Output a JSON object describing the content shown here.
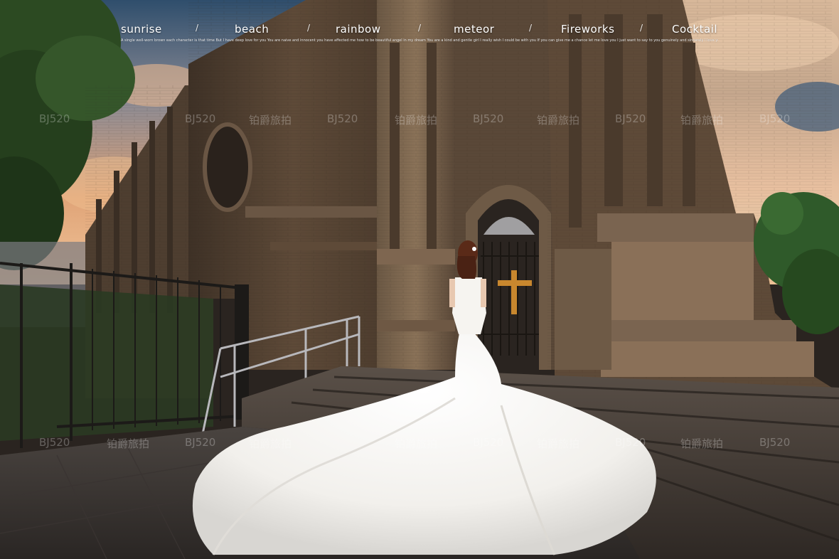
{
  "caption": {
    "words": [
      "sunrise",
      "beach",
      "rainbow",
      "meteor",
      "Fireworks",
      "Cocktail"
    ],
    "separator": "/",
    "poem": "A single well-worn brown each character is that time But I have deep love for you You are naive and innocent you have affected me how to be beautiful angel in my dream You are a kind and gentle girl I really wish I could be with you If you can give me a chance let me love you I just want to say to you genuinely and sincerely I love you"
  },
  "watermarks": [
    "BJ520",
    "铂爵旅拍"
  ],
  "colors": {
    "sky_top": "#3b5a78",
    "sky_warm": "#e8a878",
    "brick": "#5a4634",
    "brick_dark": "#3a2e24",
    "gown": "#f4f2ee",
    "cross": "#c8872e",
    "foliage": "#2f5a2a"
  }
}
